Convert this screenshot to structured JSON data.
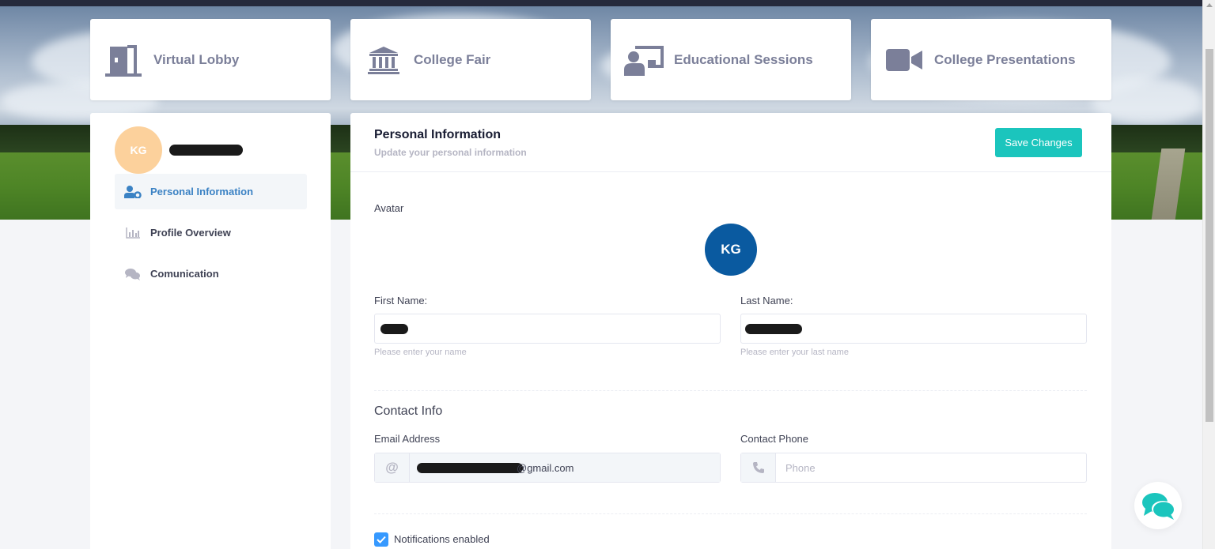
{
  "nav_cards": [
    {
      "label": "Virtual Lobby",
      "icon": "door-open-icon"
    },
    {
      "label": "College Fair",
      "icon": "institution-icon"
    },
    {
      "label": "Educational Sessions",
      "icon": "presentation-icon"
    },
    {
      "label": "College Presentations",
      "icon": "video-camera-icon"
    }
  ],
  "sidebar": {
    "user_initials": "KG",
    "items": [
      {
        "label": "Personal Information",
        "icon": "user-settings-icon",
        "active": true
      },
      {
        "label": "Profile Overview",
        "icon": "bar-chart-icon",
        "active": false
      },
      {
        "label": "Comunication",
        "icon": "chat-bubbles-icon",
        "active": false
      }
    ]
  },
  "main": {
    "title": "Personal Information",
    "subtitle": "Update your personal information",
    "save_label": "Save Changes",
    "avatar_label": "Avatar",
    "avatar_initials": "KG",
    "first_name_label": "First Name:",
    "first_name_hint": "Please enter your name",
    "last_name_label": "Last Name:",
    "last_name_hint": "Please enter your last name",
    "contact_section": "Contact Info",
    "email_label": "Email Address",
    "email_prefix": "@",
    "email_visible_suffix": "@gmail.com",
    "phone_label": "Contact Phone",
    "phone_placeholder": "Phone",
    "notifications_label": "Notifications enabled",
    "notifications_checked": true
  },
  "colors": {
    "accent_teal": "#1bc5bd",
    "avatar_blue": "#0a5aa0",
    "avatar_peach": "#fcd19c",
    "active_blue": "#3b82c4",
    "checkbox_blue": "#3699ff"
  }
}
